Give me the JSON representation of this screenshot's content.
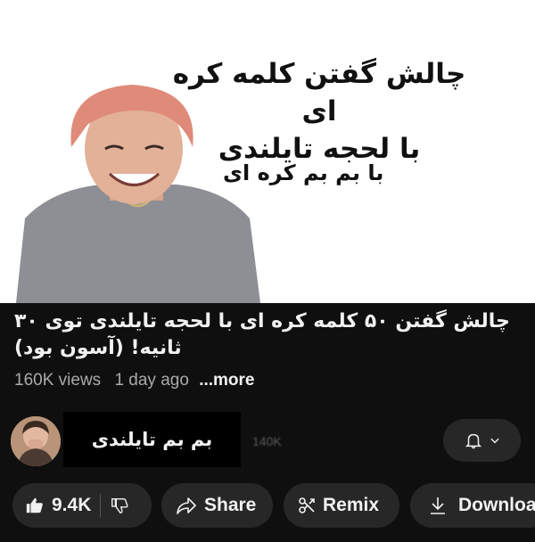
{
  "thumbnail": {
    "title_line1": "چالش گفتن کلمه کره ای",
    "title_line2": "با لحجه تایلندی",
    "subtitle": "با بم بم کره ای"
  },
  "video": {
    "title": "چالش گفتن ۵۰ کلمه کره ای با لحجه تایلندی توی ۳۰ ثانیه! (آسون بود)",
    "views": "160K views",
    "age": "1 day ago",
    "more": "...more"
  },
  "channel": {
    "name": "بم بم تایلندی",
    "subscribers": "140K"
  },
  "actions": {
    "likes": "9.4K",
    "share": "Share",
    "remix": "Remix",
    "download": "Downloa"
  },
  "icons": [
    "like-icon",
    "dislike-icon",
    "share-icon",
    "remix-icon",
    "download-icon",
    "bell-icon",
    "chevron-down-icon"
  ]
}
